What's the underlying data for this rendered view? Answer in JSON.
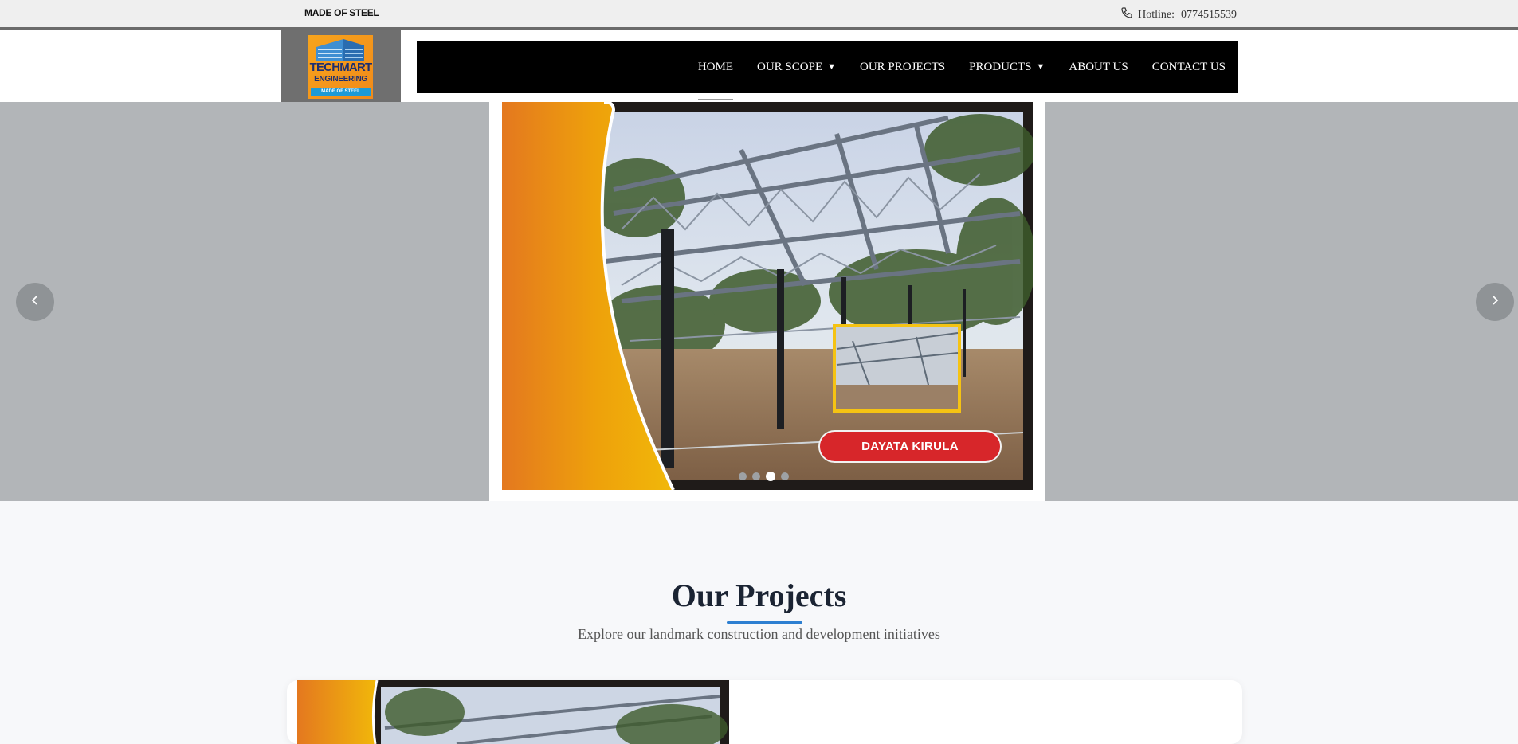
{
  "topbar": {
    "tagline": "MADE OF STEEL",
    "hotline_label": "Hotline:",
    "hotline_number": "0774515539",
    "hotline_icon": "phone-icon"
  },
  "logo": {
    "line1": "TECHMART",
    "line2": "ENGINEERING",
    "line3": "MADE OF STEEL"
  },
  "nav": {
    "items": [
      {
        "label": "HOME",
        "active": true
      },
      {
        "label": "OUR SCOPE",
        "dropdown": true
      },
      {
        "label": "OUR PROJECTS"
      },
      {
        "label": "PRODUCTS",
        "dropdown": true
      },
      {
        "label": "ABOUT US"
      },
      {
        "label": "CONTACT US"
      }
    ],
    "caret": "▼"
  },
  "hero": {
    "slide_button": "DAYATA KIRULA",
    "slide_count": 4,
    "active_slide": 3,
    "prev_icon": "chevron-left-icon",
    "next_icon": "chevron-right-icon"
  },
  "projects": {
    "title": "Our Projects",
    "subtitle": "Explore our landmark construction and development initiatives"
  },
  "colors": {
    "nav_bg": "#000000",
    "accent": "#2d7fd1",
    "slide_button": "#d7262a"
  }
}
